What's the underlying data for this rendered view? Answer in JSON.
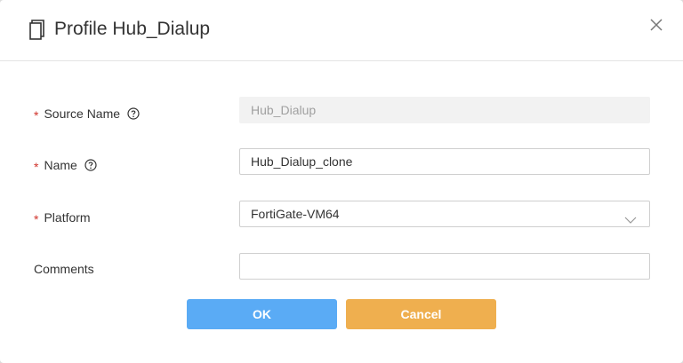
{
  "dialog": {
    "title": "Profile Hub_Dialup",
    "title_icon": "clone-icon",
    "close_icon": "close-icon"
  },
  "form": {
    "required_marker": "*",
    "source_name": {
      "label": "Source Name",
      "value": "Hub_Dialup",
      "help_icon": "help-circle-icon",
      "disabled": true
    },
    "name": {
      "label": "Name",
      "value": "Hub_Dialup_clone",
      "help_icon": "help-circle-icon"
    },
    "platform": {
      "label": "Platform",
      "value": "FortiGate-VM64",
      "chevron_icon": "chevron-down-icon"
    },
    "comments": {
      "label": "Comments",
      "value": ""
    }
  },
  "buttons": {
    "ok_label": "OK",
    "cancel_label": "Cancel"
  },
  "colors": {
    "required": "#d0342c",
    "ok_button": "#5aabf5",
    "cancel_button": "#efaf4f"
  }
}
